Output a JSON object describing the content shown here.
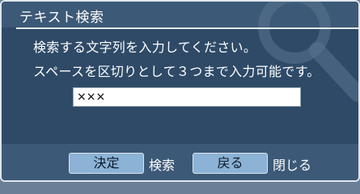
{
  "dialog": {
    "title": "テキスト検索",
    "message_line1": "検索する文字列を入力してください。",
    "message_line2": "スペースを区切りとして３つまで入力可能です。",
    "watermark_icon": "magnifier-icon"
  },
  "search": {
    "value": "×××"
  },
  "buttons": {
    "ok_label": "決定",
    "ok_caption": "検索",
    "back_label": "戻る",
    "back_caption": "閉じる"
  },
  "colors": {
    "dialog_background": "#2e4a67",
    "bar_background": "#3c5977",
    "button_fill": "#8cb2d5",
    "border": "#dfe6ee"
  }
}
